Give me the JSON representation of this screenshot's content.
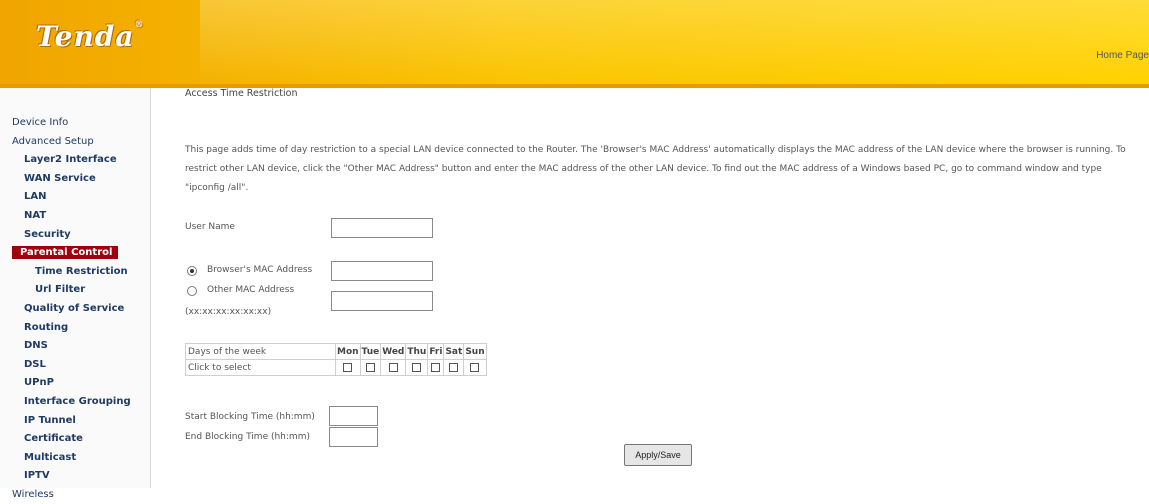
{
  "header": {
    "logo_text": "Tenda",
    "logo_mark": "®",
    "home_link": "Home Page"
  },
  "sidebar": {
    "items": [
      {
        "label": "Device Info",
        "level": 1
      },
      {
        "label": "Advanced Setup",
        "level": 1
      },
      {
        "label": "Layer2 Interface",
        "level": 2
      },
      {
        "label": "WAN Service",
        "level": 2
      },
      {
        "label": "LAN",
        "level": 2
      },
      {
        "label": "NAT",
        "level": 2
      },
      {
        "label": "Security",
        "level": 2
      },
      {
        "label": "Parental Control",
        "level": 2,
        "active": true
      },
      {
        "label": "Time Restriction",
        "level": 3
      },
      {
        "label": "Url Filter",
        "level": 3
      },
      {
        "label": "Quality of Service",
        "level": 2
      },
      {
        "label": "Routing",
        "level": 2
      },
      {
        "label": "DNS",
        "level": 2
      },
      {
        "label": "DSL",
        "level": 2
      },
      {
        "label": "UPnP",
        "level": 2
      },
      {
        "label": "Interface Grouping",
        "level": 2
      },
      {
        "label": "IP Tunnel",
        "level": 2
      },
      {
        "label": "Certificate",
        "level": 2
      },
      {
        "label": "Multicast",
        "level": 2
      },
      {
        "label": "IPTV",
        "level": 2
      },
      {
        "label": "Wireless",
        "level": 1
      }
    ]
  },
  "main": {
    "title": "Access Time Restriction",
    "description": "This page adds time of day restriction to a special LAN device connected to the Router. The 'Browser's MAC Address' automatically displays the MAC address of the LAN device where the browser is running. To restrict other LAN device, click the \"Other MAC Address\" button and enter the MAC address of the other LAN device. To find out the MAC address of a Windows based PC, go to command window and type \"ipconfig /all\".",
    "user_name_label": "User Name",
    "user_name_value": "",
    "browser_mac_label": "Browser's MAC Address",
    "browser_mac_value": "",
    "other_mac_label": "Other MAC Address",
    "other_mac_format": "(xx:xx:xx:xx:xx:xx)",
    "other_mac_value": "",
    "selected_mac_option": "browser",
    "days_header_label": "Days of the week",
    "days": [
      "Mon",
      "Tue",
      "Wed",
      "Thu",
      "Fri",
      "Sat",
      "Sun"
    ],
    "click_to_select_label": "Click to select",
    "days_checked": [
      false,
      false,
      false,
      false,
      false,
      false,
      false
    ],
    "start_time_label": "Start Blocking Time (hh:mm)",
    "start_time_value": "",
    "end_time_label": "End Blocking Time (hh:mm)",
    "end_time_value": "",
    "apply_button": "Apply/Save"
  }
}
